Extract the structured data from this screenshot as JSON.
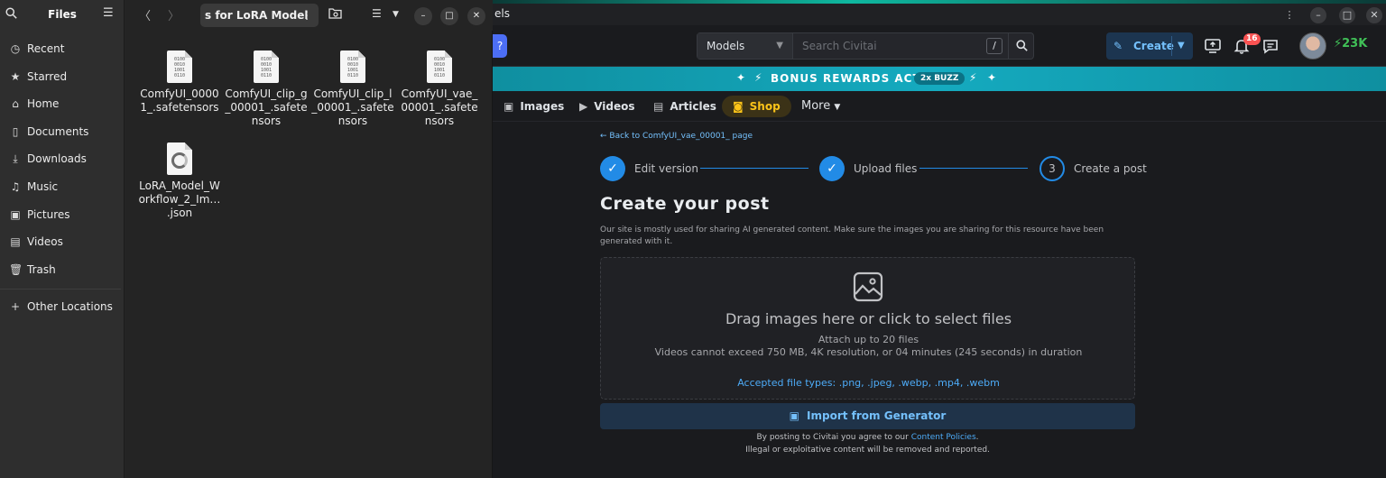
{
  "browser": {
    "window_title": "els",
    "search": {
      "type_label": "Models",
      "placeholder": "Search Civitai",
      "shortcut": "/"
    },
    "create_label": "Create",
    "notification_count": "16",
    "buzz_amount": "23K",
    "bonus": {
      "text": "BONUS REWARDS ACTIVE",
      "badge": "2x BUZZ"
    },
    "nav": {
      "images": "Images",
      "videos": "Videos",
      "articles": "Articles",
      "shop": "Shop",
      "more": "More"
    },
    "back_link": "← Back to ComfyUI_vae_00001_ page",
    "steps": [
      {
        "label": "Edit version",
        "state": "done"
      },
      {
        "label": "Upload files",
        "state": "done"
      },
      {
        "number": "3",
        "label": "Create a post",
        "state": "current"
      }
    ],
    "post": {
      "title": "Create your post",
      "description": "Our site is mostly used for sharing AI generated content. Make sure the images you are sharing for this resource have been generated with it.",
      "drop_main": "Drag images here or click to select files",
      "drop_sub1": "Attach up to 20 files",
      "drop_sub2": "Videos cannot exceed 750 MB, 4K resolution, or 04 minutes (245 seconds) in duration",
      "accepted": "Accepted file types: .png, .jpeg, .webp, .mp4, .webm",
      "import_label": "Import from Generator",
      "terms_prefix": "By posting to Civitai you agree to our",
      "terms_link": "Content Policies",
      "terms_suffix": ".",
      "terms_line2": "Illegal or exploitative content will be removed and reported."
    },
    "colors": {
      "accent": "#228be6",
      "bonus_bar": "#15aabf",
      "buzz": "#40c057",
      "shop": "#fcc419"
    }
  },
  "files": {
    "app_title": "Files",
    "path_label": "s for LoRA Model",
    "sidebar": [
      {
        "icon": "clock-icon",
        "label": "Recent"
      },
      {
        "icon": "star-icon",
        "label": "Starred"
      },
      {
        "icon": "home-icon",
        "label": "Home"
      },
      {
        "icon": "document-icon",
        "label": "Documents"
      },
      {
        "icon": "download-icon",
        "label": "Downloads"
      },
      {
        "icon": "music-icon",
        "label": "Music"
      },
      {
        "icon": "picture-icon",
        "label": "Pictures"
      },
      {
        "icon": "video-icon",
        "label": "Videos"
      },
      {
        "icon": "trash-icon",
        "label": "Trash"
      }
    ],
    "other_locations": "Other Locations",
    "items": [
      {
        "name": "ComfyUI_00001_.safetensors",
        "kind": "binary"
      },
      {
        "name": "ComfyUI_clip_g_00001_.safetensors",
        "kind": "binary"
      },
      {
        "name": "ComfyUI_clip_l_00001_.safetensors",
        "kind": "binary"
      },
      {
        "name": "ComfyUI_vae_00001_.safetensors",
        "kind": "binary"
      },
      {
        "name": "LoRA_Model_Workflow_2_Im… .json",
        "kind": "json"
      }
    ]
  }
}
